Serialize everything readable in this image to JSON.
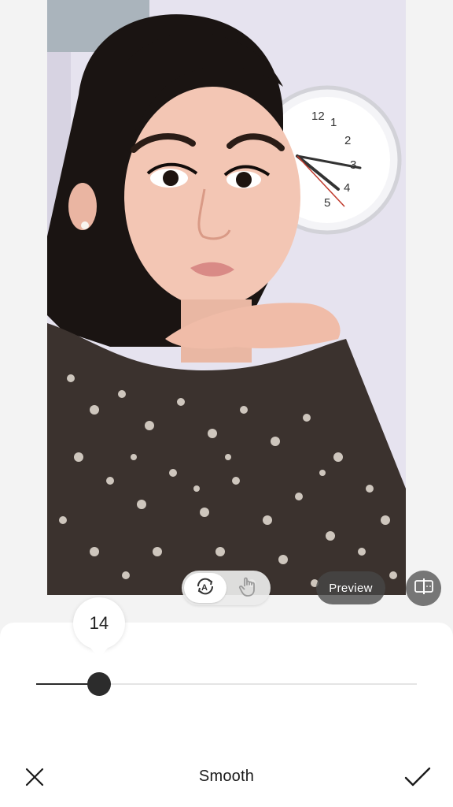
{
  "editor": {
    "tool_title": "Smooth",
    "preview_label": "Preview"
  },
  "slider": {
    "value": "14",
    "value_fraction": 0.165
  },
  "mode_toggle": {
    "selected": "auto",
    "auto_icon": "auto-retouch-icon",
    "manual_icon": "hand-touch-icon"
  },
  "icons": {
    "cancel": "close-icon",
    "confirm": "checkmark-icon",
    "compare": "compare-split-icon"
  },
  "colors": {
    "background": "#f3f3f3",
    "panel": "#ffffff",
    "slider_active": "#2c2c2c",
    "preview_pill": "#464646"
  }
}
